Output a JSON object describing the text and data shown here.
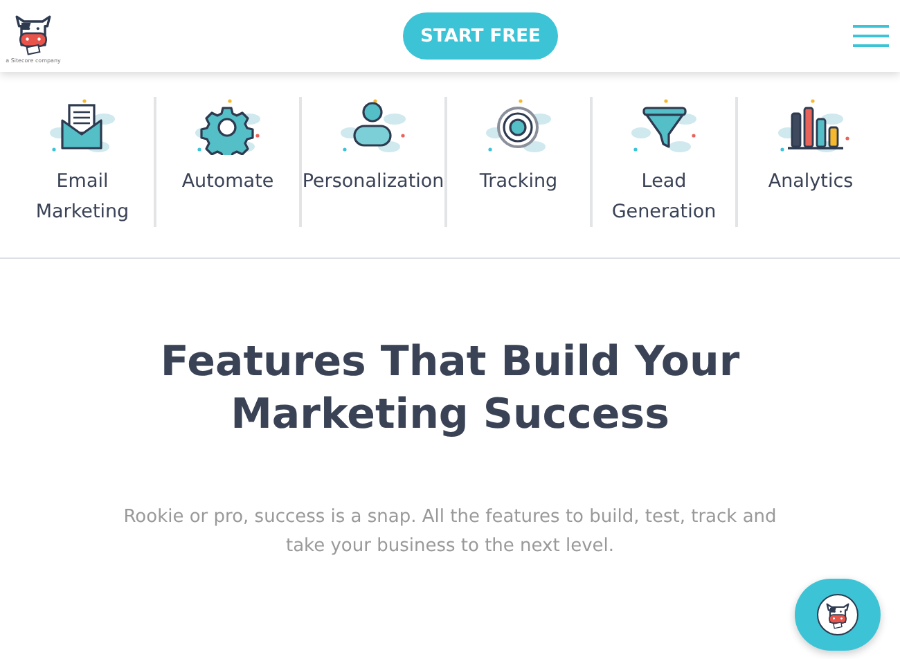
{
  "header": {
    "logo_caption": "a Sitecore company",
    "cta": "START FREE"
  },
  "features": [
    {
      "kind": "envelope",
      "label": "Email Marketing"
    },
    {
      "kind": "gear",
      "label": "Automate"
    },
    {
      "kind": "person",
      "label": "Personalization"
    },
    {
      "kind": "target",
      "label": "Tracking"
    },
    {
      "kind": "funnel",
      "label": "Lead Generation"
    },
    {
      "kind": "bars",
      "label": "Analytics"
    }
  ],
  "hero": {
    "title": "Features That Build Your Marketing Success",
    "subtitle": "Rookie or pro, success is a snap. All the features to build, test, track and take your business to the next level."
  }
}
